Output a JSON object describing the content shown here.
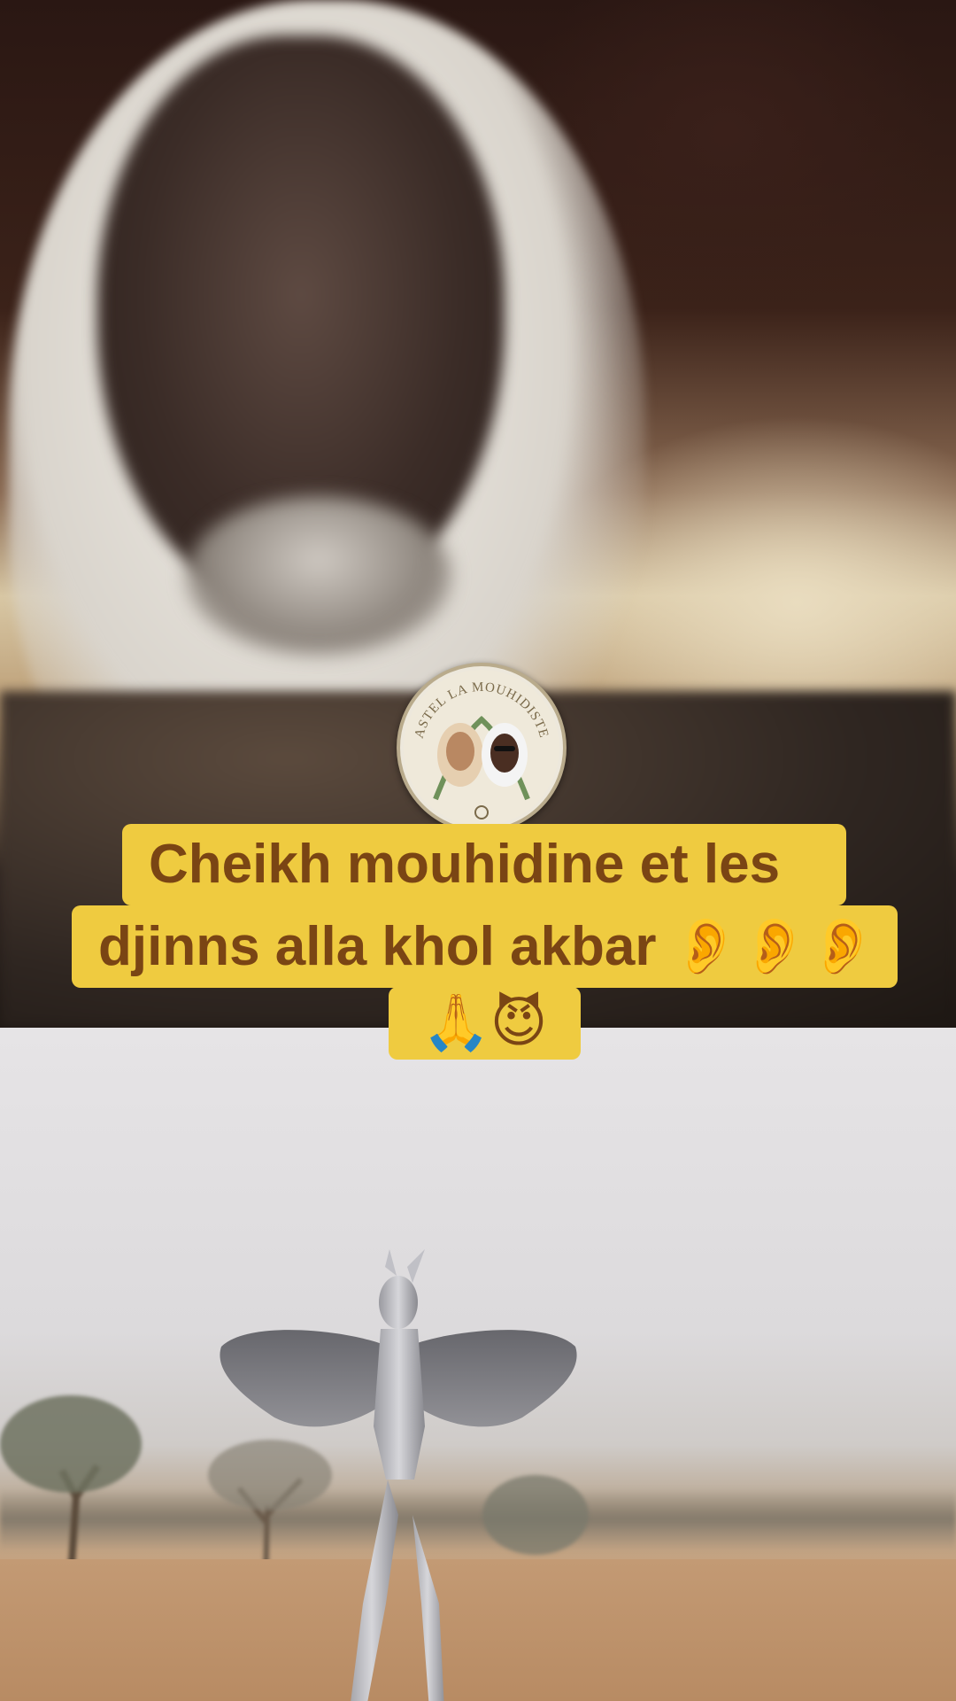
{
  "video": {
    "top_scene": "blurred video still",
    "bottom_scene": "video still"
  },
  "profile": {
    "avatar_text": "ASTEL LA MOUHIDISTE"
  },
  "caption": {
    "line1": "Cheikh mouhidine et les",
    "line2_text": "djinns alla khol akbar",
    "line2_emoji": "👂👂👂",
    "line3_emoji": "🙏😈"
  },
  "colors": {
    "caption_bg": "#efcb40",
    "caption_text": "#7a4514"
  }
}
